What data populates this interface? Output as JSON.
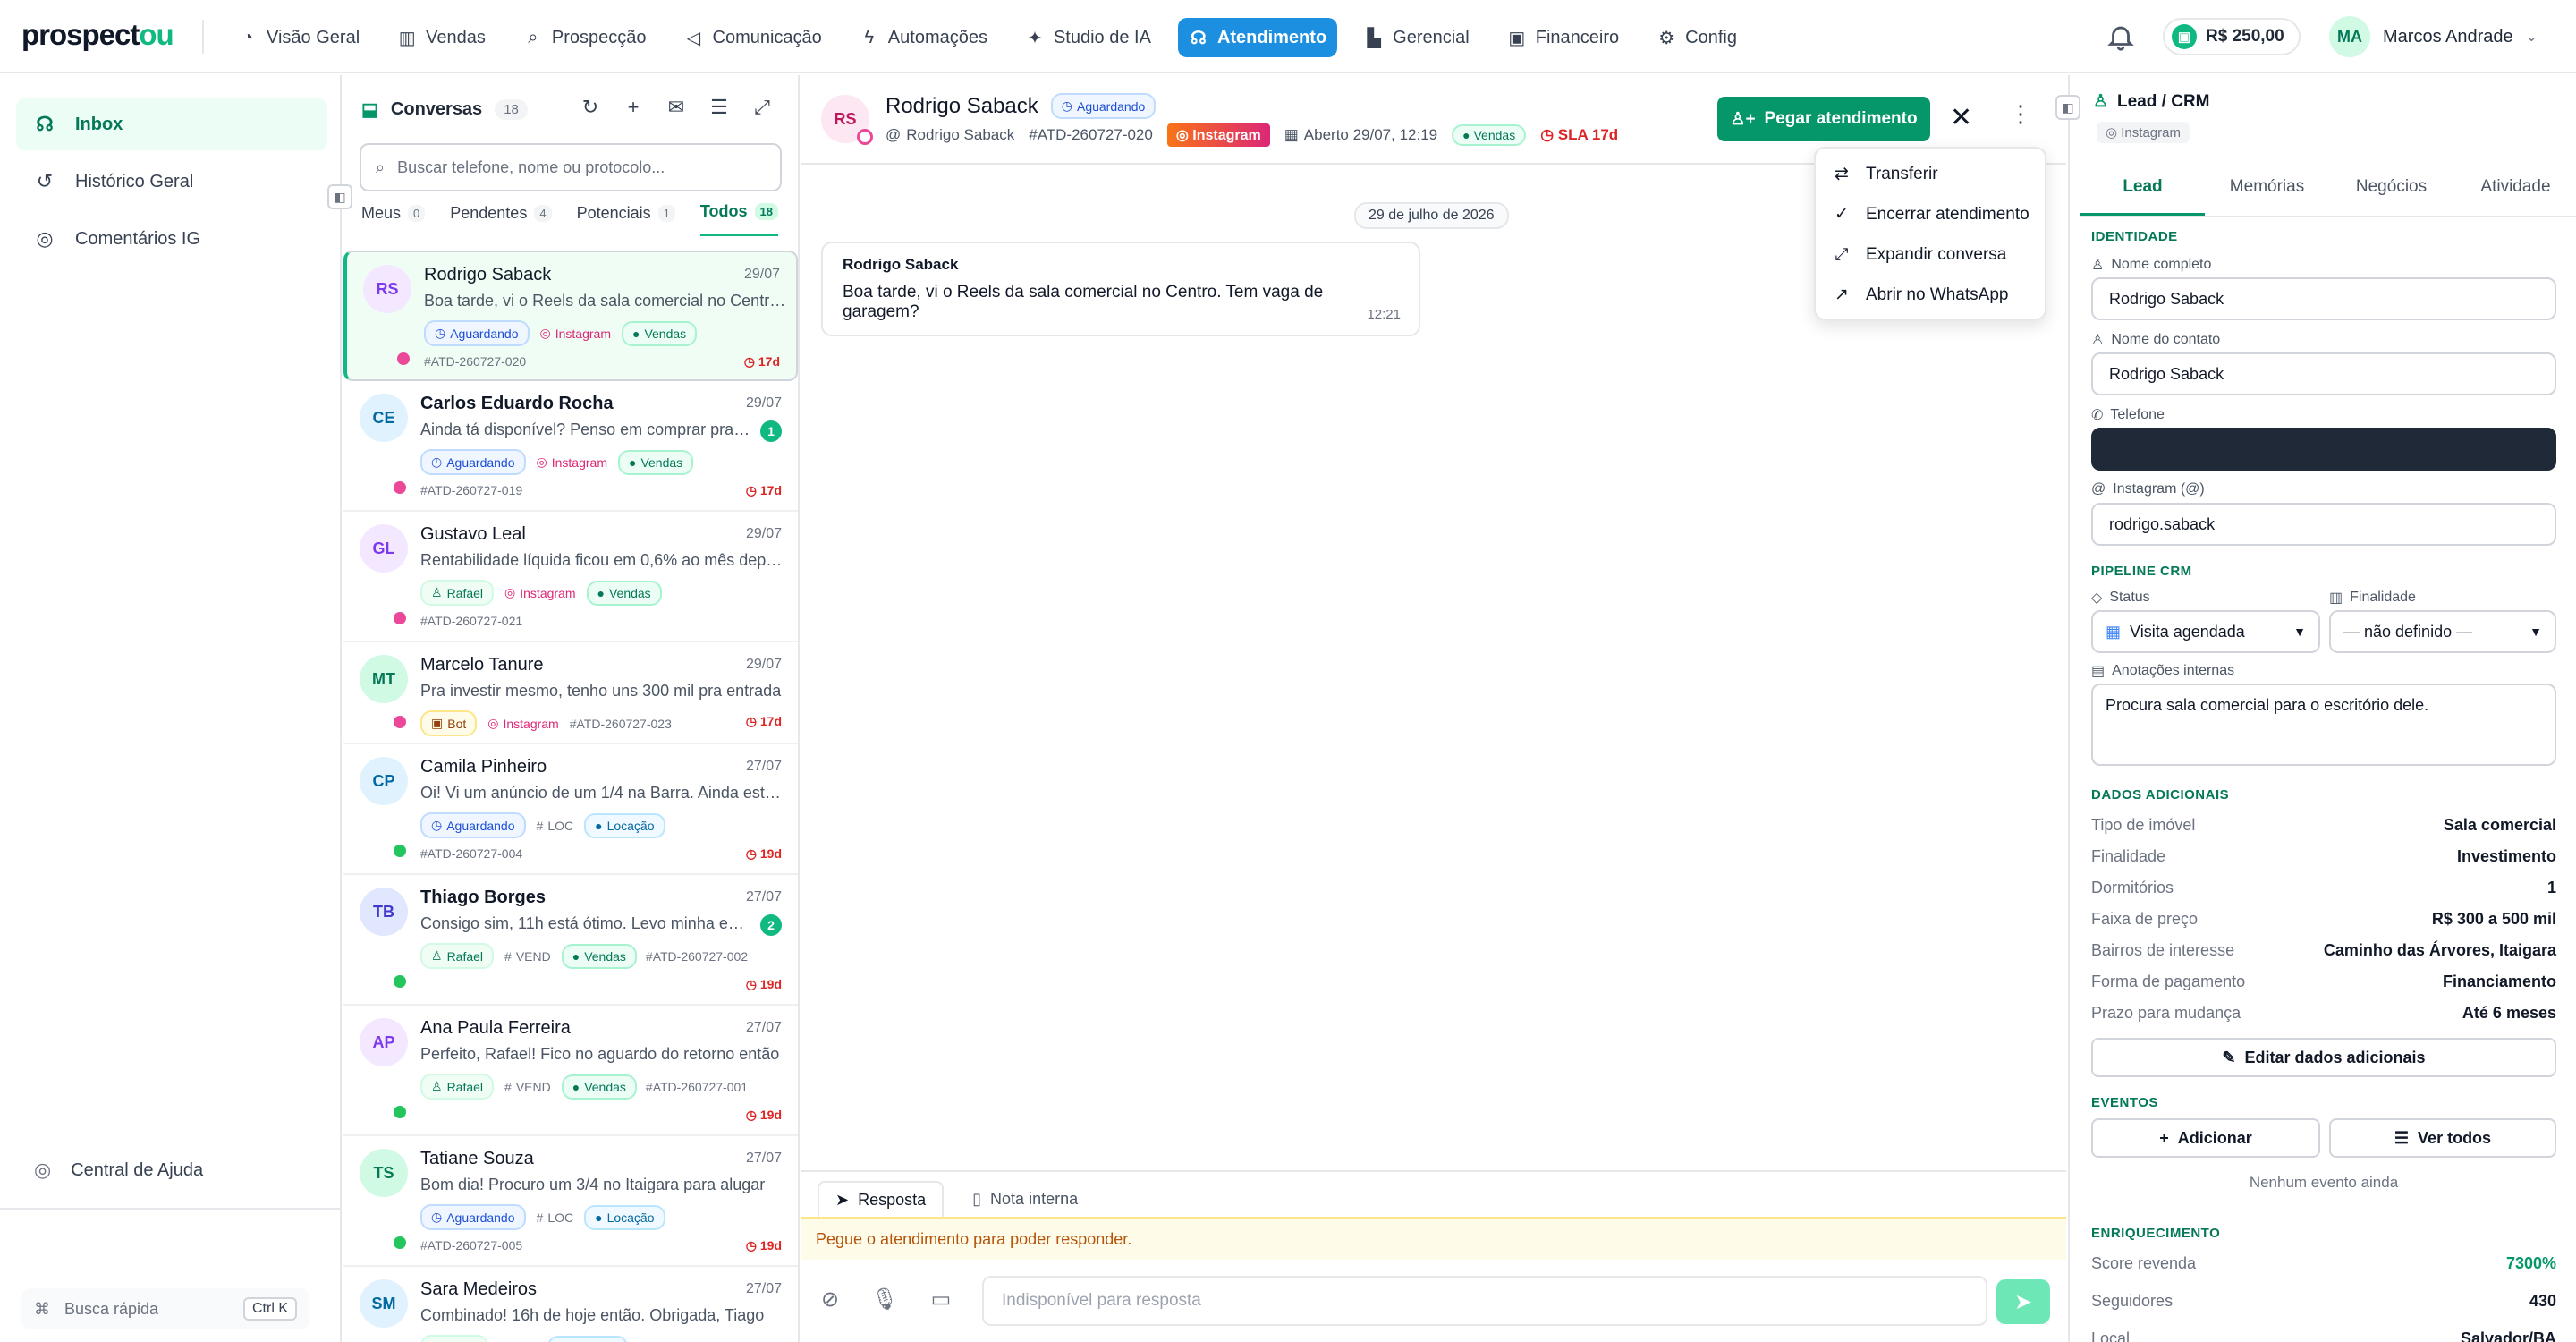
{
  "brand": {
    "prefix": "prospect",
    "suffix": "ou"
  },
  "nav": [
    {
      "label": "Visão Geral",
      "icon": "gauge-icon",
      "glyph": "◔"
    },
    {
      "label": "Vendas",
      "icon": "building-icon",
      "glyph": "▥"
    },
    {
      "label": "Prospecção",
      "icon": "search-icon",
      "glyph": "⌕"
    },
    {
      "label": "Comunicação",
      "icon": "megaphone-icon",
      "glyph": "◁"
    },
    {
      "label": "Automações",
      "icon": "zap-icon",
      "glyph": "ϟ"
    },
    {
      "label": "Studio de IA",
      "icon": "sparkles-icon",
      "glyph": "✦"
    },
    {
      "label": "Atendimento",
      "icon": "headset-icon",
      "glyph": "☊",
      "active": true
    },
    {
      "label": "Gerencial",
      "icon": "bar-chart-icon",
      "glyph": "▙"
    },
    {
      "label": "Financeiro",
      "icon": "wallet-icon",
      "glyph": "▣"
    },
    {
      "label": "Config",
      "icon": "sliders-icon",
      "glyph": "⚙"
    }
  ],
  "wallet": {
    "balance": "R$ 250,00"
  },
  "user": {
    "initials": "MA",
    "name": "Marcos Andrade"
  },
  "sidebar": {
    "items": [
      {
        "label": "Inbox",
        "icon": "headset-icon",
        "glyph": "☊",
        "active": true
      },
      {
        "label": "Histórico Geral",
        "icon": "history-icon",
        "glyph": "↺"
      },
      {
        "label": "Comentários IG",
        "icon": "instagram-icon",
        "glyph": "◎"
      }
    ],
    "help": "Central de Ajuda",
    "quick_search": "Busca rápida",
    "shortcut": "Ctrl K"
  },
  "conversations_panel": {
    "title": "Conversas",
    "count": "18",
    "search_placeholder": "Buscar telefone, nome ou protocolo...",
    "filters": [
      {
        "label": "Meus",
        "count": "0"
      },
      {
        "label": "Pendentes",
        "count": "4"
      },
      {
        "label": "Potenciais",
        "count": "1"
      },
      {
        "label": "Todos",
        "count": "18",
        "active": true
      }
    ]
  },
  "conversations": [
    {
      "initials": "RS",
      "avclr": "#f3e8ff",
      "avtxt": "#7c3aed",
      "name": "Rodrigo Saback",
      "date": "29/07",
      "msg": "Boa tarde, vi o Reels da sala comercial no Centro. Tem vaga de garagem?",
      "tags": [
        {
          "t": "wait",
          "l": "Aguardando",
          "g": "◷"
        },
        {
          "t": "ig",
          "l": "Instagram",
          "g": "◎"
        },
        {
          "t": "vendas",
          "l": "Vendas",
          "g": "●"
        }
      ],
      "proto": "#ATD-260727-020",
      "sla": "17d",
      "channel": "#ec4899",
      "selected": true
    },
    {
      "initials": "CE",
      "avclr": "#e0f2fe",
      "avtxt": "#0369a1",
      "name": "Carlos Eduardo Rocha",
      "date": "29/07",
      "msg": "Ainda tá disponível? Penso em comprar pra investir",
      "unread": "1",
      "tags": [
        {
          "t": "wait",
          "l": "Aguardando",
          "g": "◷"
        },
        {
          "t": "ig",
          "l": "Instagram",
          "g": "◎"
        },
        {
          "t": "vendas",
          "l": "Vendas",
          "g": "●"
        }
      ],
      "proto": "#ATD-260727-019",
      "sla": "17d",
      "channel": "#ec4899",
      "bold": true
    },
    {
      "initials": "GL",
      "avclr": "#f3e8ff",
      "avtxt": "#7c3aed",
      "name": "Gustavo Leal",
      "date": "29/07",
      "msg": "Rentabilidade líquida ficou em 0,6% ao mês depois dos custos",
      "tags": [
        {
          "t": "agent",
          "l": "Rafael",
          "g": "♙"
        },
        {
          "t": "ig",
          "l": "Instagram",
          "g": "◎"
        },
        {
          "t": "vendas",
          "l": "Vendas",
          "g": "●"
        }
      ],
      "proto": "#ATD-260727-021",
      "sla": "",
      "channel": "#ec4899"
    },
    {
      "initials": "MT",
      "avclr": "#d1fae5",
      "avtxt": "#047857",
      "name": "Marcelo Tanure",
      "date": "29/07",
      "msg": "Pra investir mesmo, tenho uns 300 mil pra entrada",
      "tags": [
        {
          "t": "bot",
          "l": "Bot",
          "g": "▣"
        },
        {
          "t": "ig",
          "l": "Instagram",
          "g": "◎"
        },
        {
          "t": "proto",
          "l": "#ATD-260727-023",
          "g": ""
        }
      ],
      "proto": "",
      "sla": "17d",
      "channel": "#ec4899",
      "compact": true
    },
    {
      "initials": "CP",
      "avclr": "#e0f2fe",
      "avtxt": "#0369a1",
      "name": "Camila Pinheiro",
      "date": "27/07",
      "msg": "Oi! Vi um anúncio de um 1/4 na Barra. Ainda está disponível?",
      "tags": [
        {
          "t": "wait",
          "l": "Aguardando",
          "g": "◷"
        },
        {
          "t": "hash",
          "l": "LOC",
          "g": "#"
        },
        {
          "t": "loc",
          "l": "Locação",
          "g": "●"
        }
      ],
      "proto": "#ATD-260727-004",
      "sla": "19d",
      "channel": "#22c55e"
    },
    {
      "initials": "TB",
      "avclr": "#e0e7ff",
      "avtxt": "#4338ca",
      "name": "Thiago Borges",
      "date": "27/07",
      "msg": "Consigo sim, 11h está ótimo. Levo minha esposa junto",
      "unread": "2",
      "tags": [
        {
          "t": "agent",
          "l": "Rafael",
          "g": "♙"
        },
        {
          "t": "hash",
          "l": "VEND",
          "g": "#"
        },
        {
          "t": "vendas",
          "l": "Vendas",
          "g": "●"
        },
        {
          "t": "proto",
          "l": "#ATD-260727-002",
          "g": ""
        }
      ],
      "proto": "",
      "sla": "19d",
      "channel": "#22c55e",
      "bold": true
    },
    {
      "initials": "AP",
      "avclr": "#f3e8ff",
      "avtxt": "#7c3aed",
      "name": "Ana Paula Ferreira",
      "date": "27/07",
      "msg": "Perfeito, Rafael! Fico no aguardo do retorno então",
      "tags": [
        {
          "t": "agent",
          "l": "Rafael",
          "g": "♙"
        },
        {
          "t": "hash",
          "l": "VEND",
          "g": "#"
        },
        {
          "t": "vendas",
          "l": "Vendas",
          "g": "●"
        },
        {
          "t": "proto",
          "l": "#ATD-260727-001",
          "g": ""
        }
      ],
      "proto": "",
      "sla": "19d",
      "channel": "#22c55e"
    },
    {
      "initials": "TS",
      "avclr": "#d1fae5",
      "avtxt": "#047857",
      "name": "Tatiane Souza",
      "date": "27/07",
      "msg": "Bom dia! Procuro um 3/4 no Itaigara para alugar",
      "tags": [
        {
          "t": "wait",
          "l": "Aguardando",
          "g": "◷"
        },
        {
          "t": "hash",
          "l": "LOC",
          "g": "#"
        },
        {
          "t": "loc",
          "l": "Locação",
          "g": "●"
        }
      ],
      "proto": "#ATD-260727-005",
      "sla": "19d",
      "channel": "#22c55e"
    },
    {
      "initials": "SM",
      "avclr": "#e0f2fe",
      "avtxt": "#0369a1",
      "name": "Sara Medeiros",
      "date": "27/07",
      "msg": "Combinado! 16h de hoje então. Obrigada, Tiago",
      "tags": [
        {
          "t": "agent",
          "l": "Tiago",
          "g": "♙"
        },
        {
          "t": "hash",
          "l": "LOC",
          "g": "#"
        },
        {
          "t": "loc",
          "l": "Locação",
          "g": "●"
        }
      ],
      "proto": "",
      "sla": "",
      "channel": "#22c55e"
    }
  ],
  "chat": {
    "initials": "RS",
    "name": "Rodrigo Saback",
    "status": "Aguardando",
    "handle": "Rodrigo Saback",
    "protocol": "#ATD-260727-020",
    "channel": "Instagram",
    "opened": "Aberto 29/07, 12:19",
    "department": "Vendas",
    "sla": "SLA 17d",
    "take_button": "Pegar atendimento",
    "date_divider": "29 de julho de 2026",
    "message": {
      "from": "Rodrigo Saback",
      "text": "Boa tarde, vi o Reels da sala comercial no Centro. Tem vaga de garagem?",
      "time": "12:21"
    },
    "menu": [
      {
        "label": "Transferir",
        "icon": "transfer-icon",
        "glyph": "⇄"
      },
      {
        "label": "Encerrar atendimento",
        "icon": "check-circle-icon",
        "glyph": "✓"
      },
      {
        "label": "Expandir conversa",
        "icon": "expand-icon",
        "glyph": "⤢"
      },
      {
        "label": "Abrir no WhatsApp",
        "icon": "external-link-icon",
        "glyph": "↗"
      }
    ],
    "composer": {
      "tab_reply": "Resposta",
      "tab_note": "Nota interna",
      "warning": "Pegue o atendimento para poder responder.",
      "placeholder": "Indisponível para resposta"
    }
  },
  "crm": {
    "title": "Lead / CRM",
    "channel": "Instagram",
    "tabs": [
      "Lead",
      "Memórias",
      "Negócios",
      "Atividade"
    ],
    "identity_title": "IDENTIDADE",
    "full_name_label": "Nome completo",
    "full_name": "Rodrigo Saback",
    "contact_name_label": "Nome do contato",
    "contact_name": "Rodrigo Saback",
    "phone_label": "Telefone",
    "instagram_label": "Instagram (@)",
    "instagram": "rodrigo.saback",
    "pipeline_title": "PIPELINE CRM",
    "status_label": "Status",
    "status_value": "Visita agendada",
    "purpose_label": "Finalidade",
    "purpose_value": "— não definido —",
    "notes_label": "Anotações internas",
    "notes": "Procura sala comercial para o escritório dele.",
    "extra_title": "DADOS ADICIONAIS",
    "extra": [
      {
        "k": "Tipo de imóvel",
        "v": "Sala comercial"
      },
      {
        "k": "Finalidade",
        "v": "Investimento"
      },
      {
        "k": "Dormitórios",
        "v": "1"
      },
      {
        "k": "Faixa de preço",
        "v": "R$ 300 a 500 mil"
      },
      {
        "k": "Bairros de interesse",
        "v": "Caminho das Árvores, Itaigara"
      },
      {
        "k": "Forma de pagamento",
        "v": "Financiamento"
      },
      {
        "k": "Prazo para mudança",
        "v": "Até 6 meses"
      }
    ],
    "edit_button": "Editar dados adicionais",
    "events_title": "EVENTOS",
    "add_button": "Adicionar",
    "see_all_button": "Ver todos",
    "no_events": "Nenhum evento ainda",
    "enrich_title": "ENRIQUECIMENTO",
    "enrich": [
      {
        "k": "Score revenda",
        "v": "7300%"
      },
      {
        "k": "Seguidores",
        "v": "430"
      },
      {
        "k": "Local",
        "v": "Salvador/BA"
      }
    ]
  }
}
